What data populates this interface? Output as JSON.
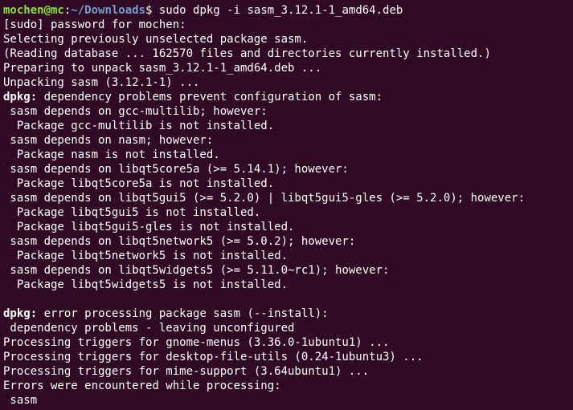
{
  "colors": {
    "background": "#300a24",
    "text": "#ffffff",
    "prompt_user": "#8ae234",
    "prompt_path": "#729fcf"
  },
  "prompt": {
    "user_host": "mochen@mc",
    "colon": ":",
    "path": "~/Downloads",
    "symbol": "$",
    "command": " sudo dpkg -i sasm_3.12.1-1_amd64.deb"
  },
  "output": {
    "lines": [
      "[sudo] password for mochen:",
      "Selecting previously unselected package sasm.",
      "(Reading database ... 162570 files and directories currently installed.)",
      "Preparing to unpack sasm_3.12.1-1_amd64.deb ...",
      "Unpacking sasm (3.12.1-1) ..."
    ],
    "dep_prefix": "dpkg:",
    "dep_message": " dependency problems prevent configuration of sasm:",
    "dep_lines": [
      " sasm depends on gcc-multilib; however:",
      "  Package gcc-multilib is not installed.",
      " sasm depends on nasm; however:",
      "  Package nasm is not installed.",
      " sasm depends on libqt5core5a (>= 5.14.1); however:",
      "  Package libqt5core5a is not installed.",
      " sasm depends on libqt5gui5 (>= 5.2.0) | libqt5gui5-gles (>= 5.2.0); however:",
      "  Package libqt5gui5 is not installed.",
      "  Package libqt5gui5-gles is not installed.",
      " sasm depends on libqt5network5 (>= 5.0.2); however:",
      "  Package libqt5network5 is not installed.",
      " sasm depends on libqt5widgets5 (>= 5.11.0~rc1); however:",
      "  Package libqt5widgets5 is not installed."
    ],
    "error_prefix": "dpkg:",
    "error_message": " error processing package sasm (--install):",
    "tail_lines": [
      " dependency problems - leaving unconfigured",
      "Processing triggers for gnome-menus (3.36.0-1ubuntu1) ...",
      "Processing triggers for desktop-file-utils (0.24-1ubuntu3) ...",
      "Processing triggers for mime-support (3.64ubuntu1) ...",
      "Errors were encountered while processing:",
      " sasm"
    ]
  }
}
